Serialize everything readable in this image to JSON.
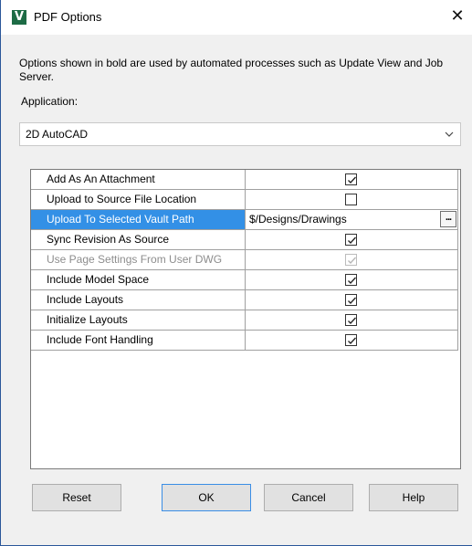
{
  "window": {
    "title": "PDF Options",
    "icon": "autodesk-vault-icon",
    "icon_glyph": "V",
    "close_glyph": "✕"
  },
  "description": "Options shown in bold are used by automated processes such as Update View and Job Server.",
  "application": {
    "label": "Application:",
    "selected": "2D AutoCAD"
  },
  "options": [
    {
      "label": "Add As An Attachment",
      "type": "checkbox",
      "checked": true,
      "enabled": true
    },
    {
      "label": "Upload to Source File Location",
      "type": "checkbox",
      "checked": false,
      "enabled": true
    },
    {
      "label": "Upload To Selected Vault Path",
      "type": "path",
      "value": "$/Designs/Drawings",
      "selected": true,
      "browse_label": "..."
    },
    {
      "label": "Sync Revision As Source",
      "type": "checkbox",
      "checked": true,
      "enabled": true
    },
    {
      "label": "Use Page Settings From User DWG",
      "type": "checkbox",
      "checked": true,
      "enabled": false
    },
    {
      "label": "Include Model Space",
      "type": "checkbox",
      "checked": true,
      "enabled": true
    },
    {
      "label": "Include Layouts",
      "type": "checkbox",
      "checked": true,
      "enabled": true
    },
    {
      "label": "Initialize Layouts",
      "type": "checkbox",
      "checked": true,
      "enabled": true
    },
    {
      "label": "Include Font Handling",
      "type": "checkbox",
      "checked": true,
      "enabled": true
    }
  ],
  "buttons": {
    "reset": "Reset",
    "ok": "OK",
    "cancel": "Cancel",
    "help": "Help"
  },
  "colors": {
    "selection": "#3390e6",
    "icon_bg": "#1d6b45",
    "default_button_border": "#3a8ee6"
  }
}
